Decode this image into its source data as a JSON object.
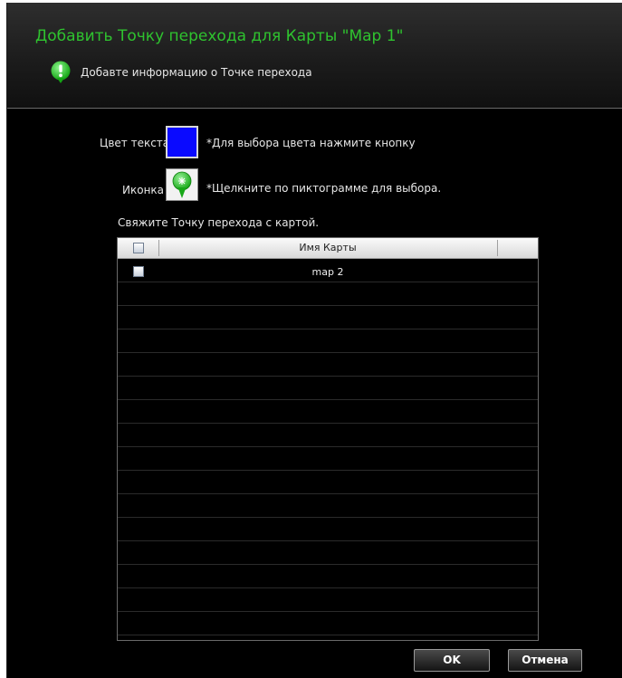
{
  "dialog": {
    "title": "Добавить Точку перехода для Карты \"Map 1\"",
    "subtitle": "Добавте информацию о Точке перехода",
    "accent_color": "#2fc32f",
    "info_icon": "info-bubble-icon"
  },
  "form": {
    "text_color_label": "Цвет текста",
    "text_color_value": "#0a0aff",
    "text_color_hint": "*Для выбора цвета нажмите кнопку",
    "icon_label": "Иконка",
    "icon_name": "map-pin-icon",
    "icon_hint": "*Щелкните по пиктограмме для выбора.",
    "link_label": "Свяжите Точку перехода с картой."
  },
  "table": {
    "columns": [
      "Имя Карты"
    ],
    "rows": [
      {
        "name": "map 2",
        "checked": false
      }
    ]
  },
  "buttons": {
    "ok": "OK",
    "cancel": "Отмена"
  }
}
